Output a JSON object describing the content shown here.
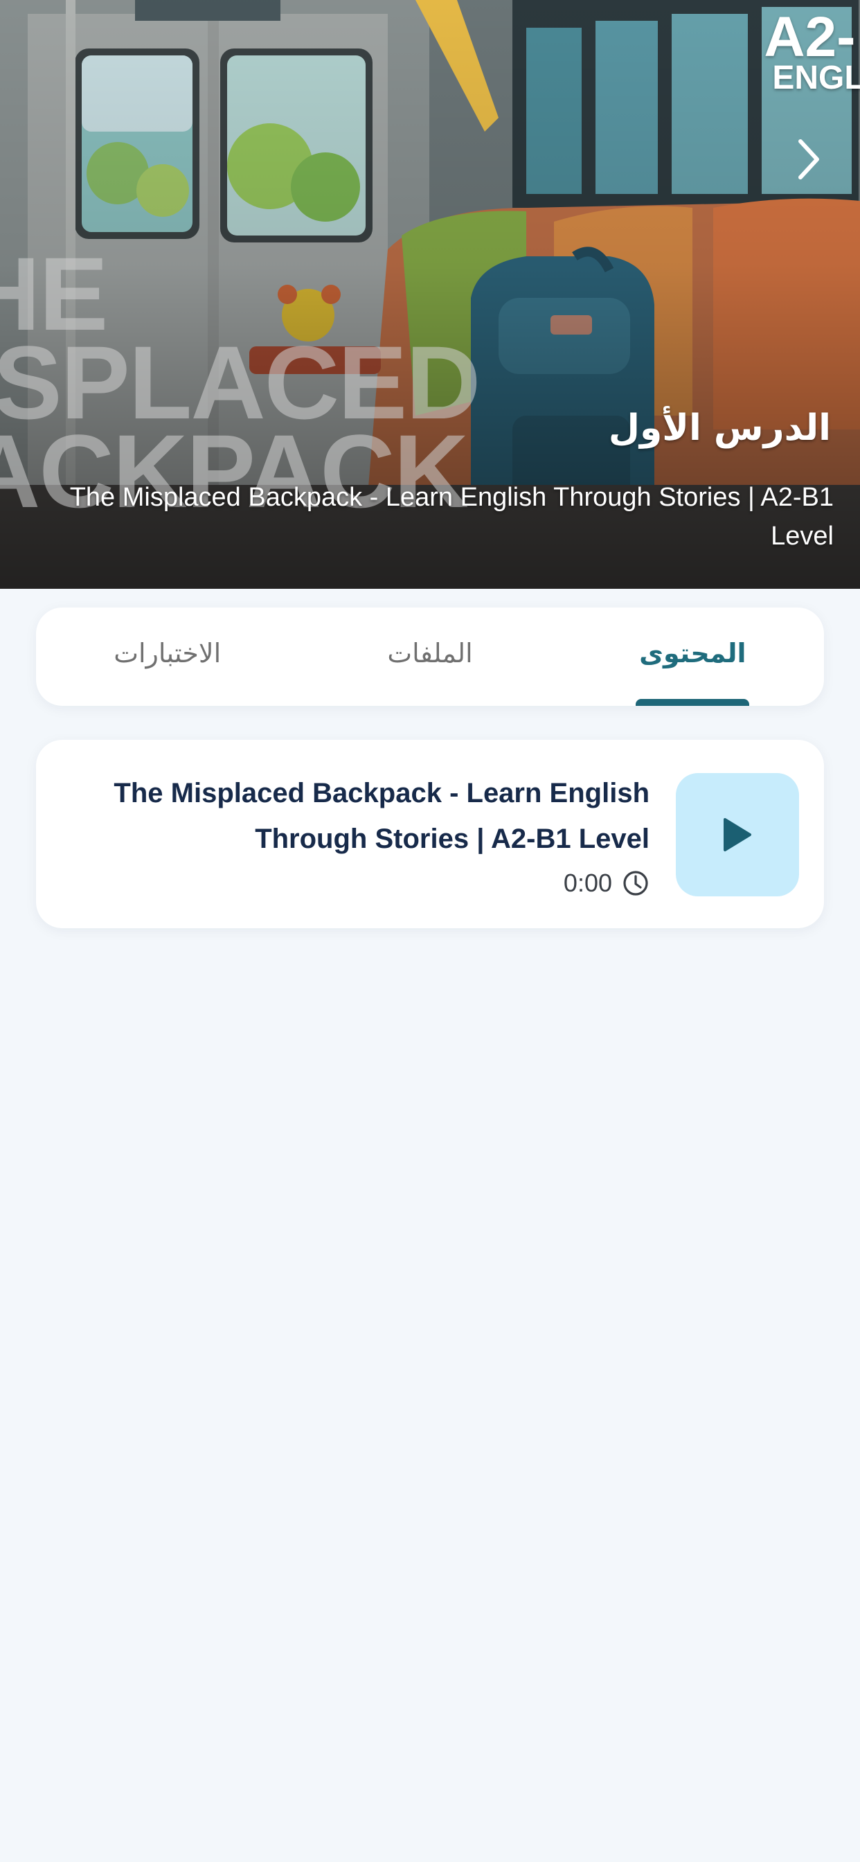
{
  "hero": {
    "cover_title": "HE\nISPLACED\nACKPACK",
    "brand_line1": "A2-",
    "brand_line2": "ENGLI",
    "lesson_heading": "الدرس الأول",
    "lesson_subtitle": "The Misplaced Backpack - Learn English Through Stories | A2-B1 Level",
    "next_icon": "chevron-right-icon"
  },
  "tabs": [
    {
      "label": "المحتوى",
      "active": true
    },
    {
      "label": "الملفات",
      "active": false
    },
    {
      "label": "الاختبارات",
      "active": false
    }
  ],
  "content": {
    "items": [
      {
        "title": "The Misplaced Backpack - Learn English Through Stories | A2-B1 Level",
        "duration": "0:00",
        "icon": "play-icon",
        "duration_icon": "clock-icon"
      }
    ]
  },
  "colors": {
    "accent": "#1d6678",
    "active_tab_text": "#1f6c7d",
    "play_tile_bg": "#c7ecfc",
    "title_text": "#172a4a",
    "background": "#f3f7fb"
  }
}
